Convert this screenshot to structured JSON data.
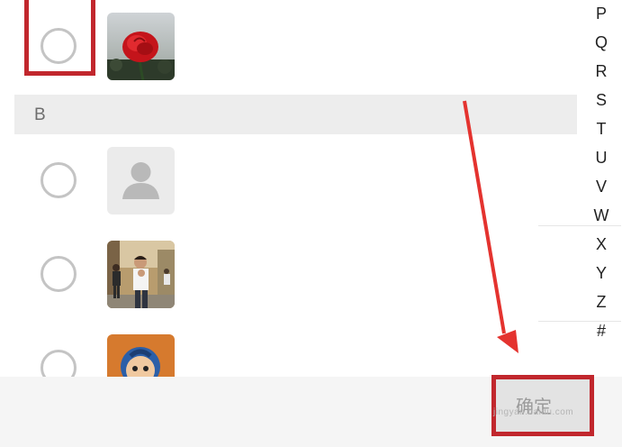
{
  "index_letters": [
    "P",
    "Q",
    "R",
    "S",
    "T",
    "U",
    "V",
    "W",
    "X",
    "Y",
    "Z",
    "#"
  ],
  "section_header": "B",
  "confirm_button_label": "确定",
  "watermark": "jingyan.baidu.com",
  "colors": {
    "highlight": "#c1272d",
    "radio_border": "#c4c4c4",
    "section_bg": "#ededed"
  },
  "contacts": [
    {
      "avatar": "rose-photo",
      "selected": false
    },
    {
      "avatar": "default-person-icon",
      "selected": false
    },
    {
      "avatar": "man-photo",
      "selected": false
    },
    {
      "avatar": "cartoon-photo",
      "selected": false
    }
  ]
}
